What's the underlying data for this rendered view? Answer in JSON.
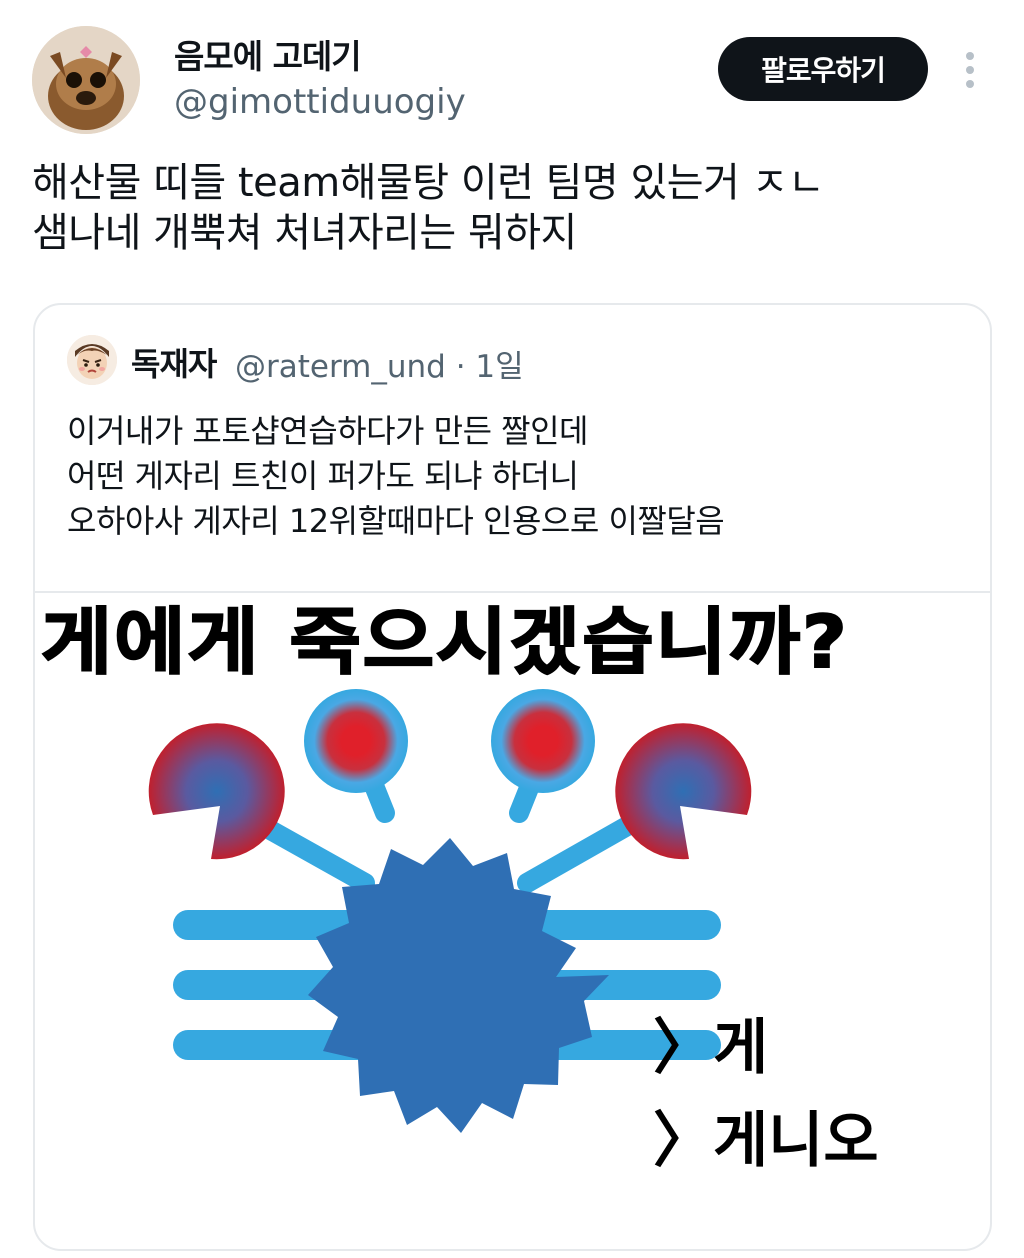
{
  "author": {
    "display_name": "음모에 고데기",
    "handle": "@gimottiduuogiy"
  },
  "follow_button": {
    "label": "팔로우하기"
  },
  "more_icon": "more-vertical-icon",
  "tweet": {
    "lines": [
      "해산물 띠들 team해물탕 이런 팀명 있는거 ㅈㄴ",
      "샘나네 개뿍쳐 처녀자리는 뭐하지"
    ]
  },
  "quote": {
    "display_name": "독재자",
    "meta": "@raterm_und · 1일",
    "lines": [
      "이거내가 포토샵연습하다가 만든 짤인데",
      "어떤 게자리 트친이 퍼가도 되냐 하더니",
      "오하아사 게자리 12위할때마다 인용으로 이짤달음"
    ],
    "image": {
      "headline": "게에게 죽으시겠습니까?",
      "option_yes": "〉게",
      "option_no": "〉게니오",
      "colors": {
        "crab_body": "#2f6fb4",
        "crab_light": "#36a8e0",
        "claw_red": "#c0202e"
      }
    }
  }
}
